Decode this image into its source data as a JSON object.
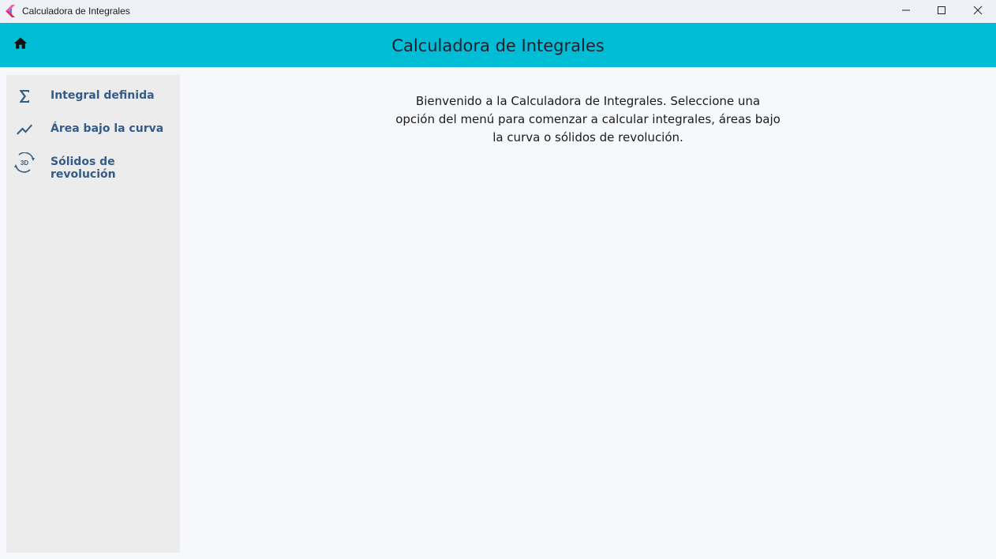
{
  "window": {
    "title": "Calculadora de Integrales",
    "logo_icon": "flutter-logo-icon",
    "controls": [
      "minimize-icon",
      "maximize-icon",
      "close-icon"
    ]
  },
  "appbar": {
    "title": "Calculadora de Integrales",
    "home_icon": "home-icon",
    "color": "#00bcd4"
  },
  "sidebar": {
    "items": [
      {
        "label": "Integral definida",
        "icon": "sigma-icon"
      },
      {
        "label": "Área bajo la curva",
        "icon": "trending-line-icon"
      },
      {
        "label": "Sólidos de revolución",
        "icon": "3d-rotation-icon"
      }
    ],
    "label_color": "#355b88"
  },
  "main": {
    "welcome_text": "Bienvenido a la Calculadora de Integrales. Seleccione una opción del menú para comenzar a calcular integrales, áreas bajo la curva o sólidos de revolución."
  }
}
